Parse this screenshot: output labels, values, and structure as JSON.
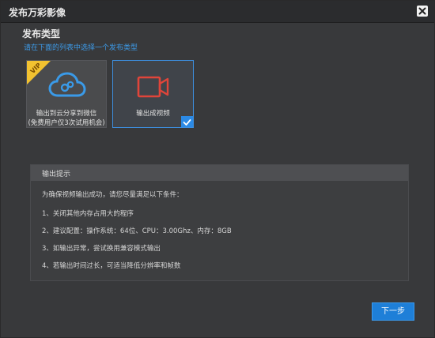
{
  "window": {
    "title": "发布万彩影像"
  },
  "publish_type": {
    "heading": "发布类型",
    "subtitle": "请在下面的列表中选择一个发布类型",
    "options": [
      {
        "label_line1": "输出到云分享到微信",
        "label_line2": "(免费用户仅3次试用机会)",
        "icon": "cloud-icon",
        "badge": "VIP",
        "selected": false
      },
      {
        "label_line1": "输出成视频",
        "icon": "video-camera-icon",
        "selected": true
      }
    ]
  },
  "tips": {
    "header": "输出提示",
    "lines": [
      "为确保视频输出成功，请您尽量满足以下条件：",
      "1、关闭其他内存占用大的程序",
      "2、建议配置：操作系统：64位、CPU：3.00Ghz、内存：8GB",
      "3、如输出异常，尝试换用兼容模式输出",
      "4、若输出时间过长，可适当降低分辨率和帧数"
    ]
  },
  "footer": {
    "next_label": "下一步"
  },
  "colors": {
    "accent": "#2b8ae6",
    "vip": "#f2c230",
    "video_icon": "#e0453a"
  }
}
